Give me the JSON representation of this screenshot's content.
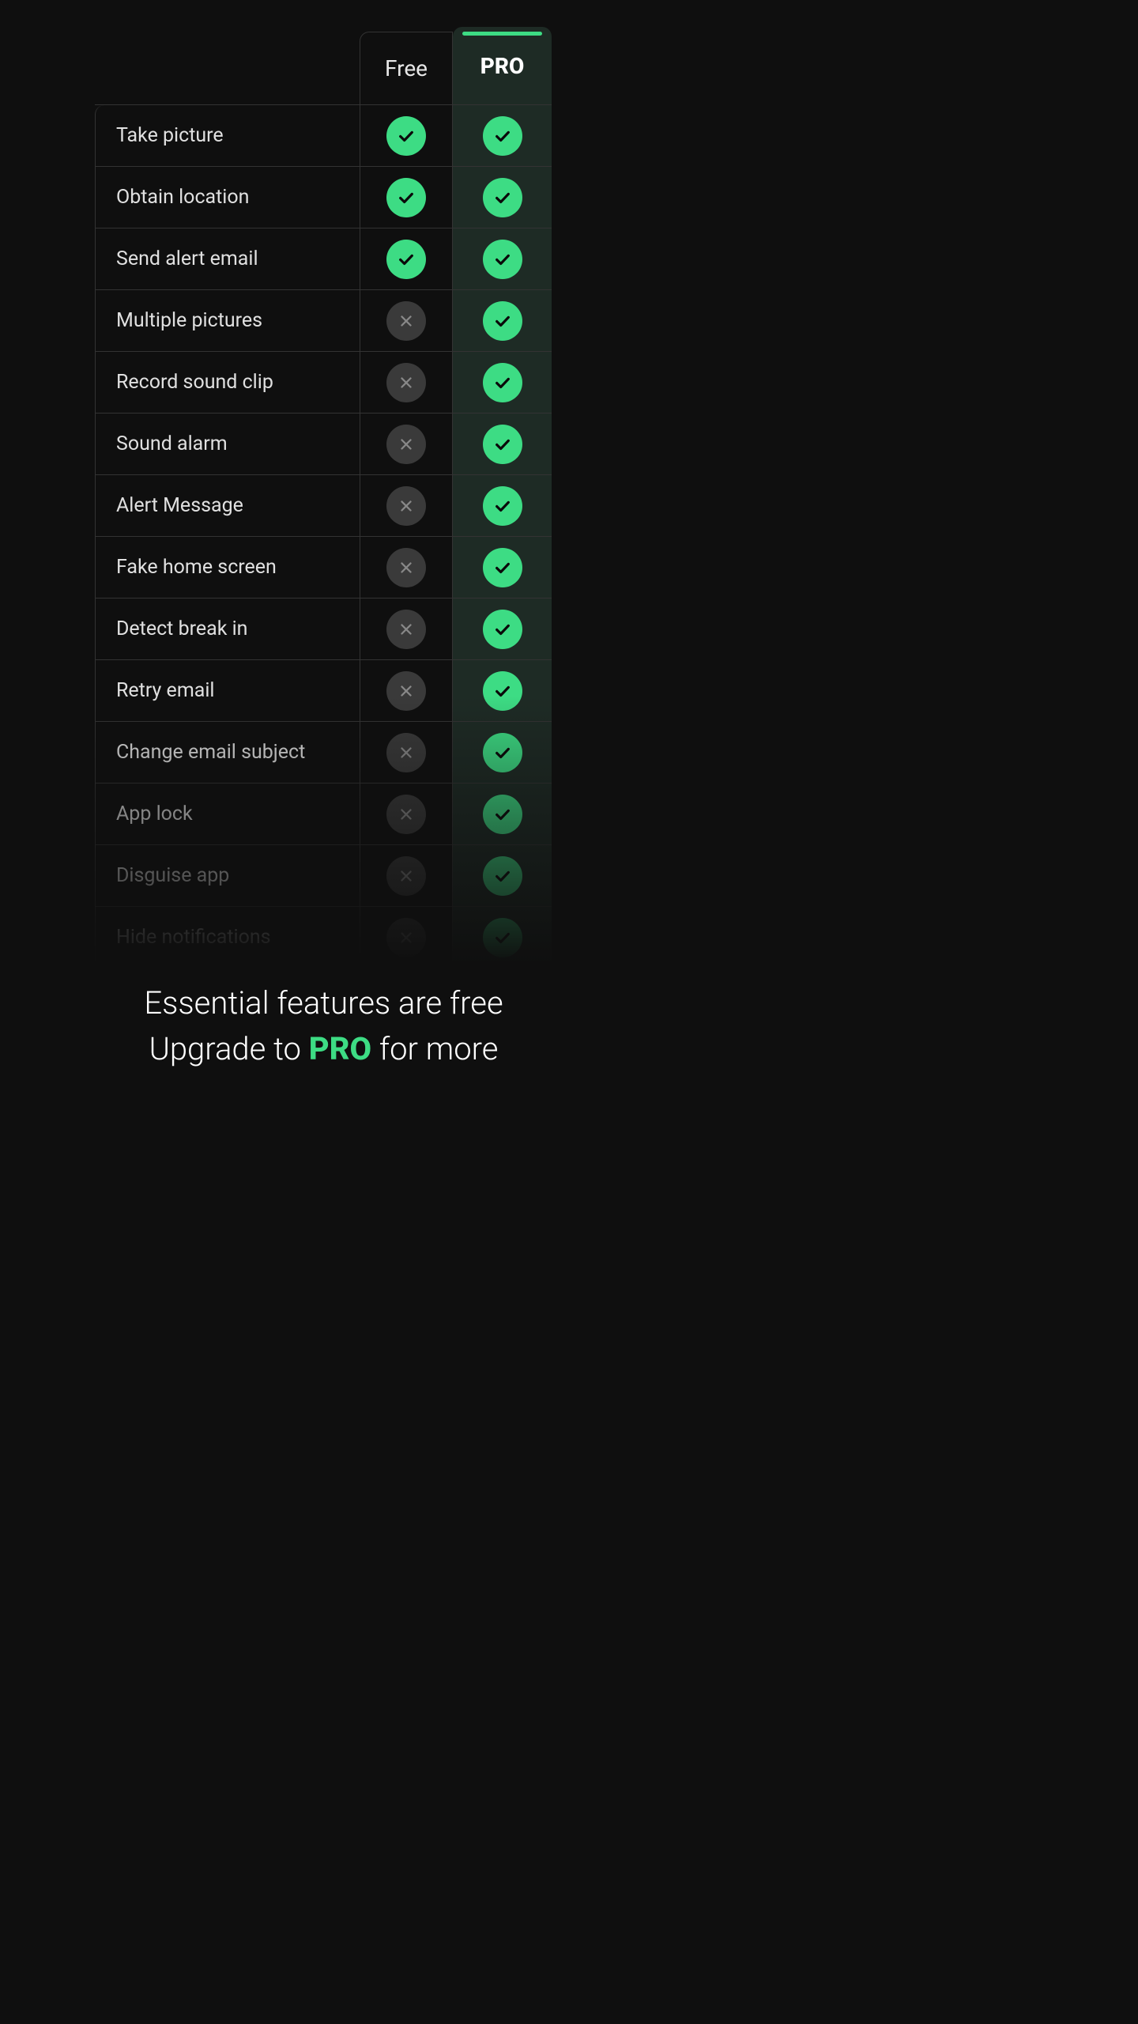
{
  "headers": {
    "free": "Free",
    "pro": "PRO"
  },
  "features": [
    {
      "label": "Take picture",
      "free": true,
      "pro": true
    },
    {
      "label": "Obtain location",
      "free": true,
      "pro": true
    },
    {
      "label": "Send alert email",
      "free": true,
      "pro": true
    },
    {
      "label": "Multiple pictures",
      "free": false,
      "pro": true
    },
    {
      "label": "Record sound clip",
      "free": false,
      "pro": true
    },
    {
      "label": "Sound alarm",
      "free": false,
      "pro": true
    },
    {
      "label": "Alert Message",
      "free": false,
      "pro": true
    },
    {
      "label": "Fake home screen",
      "free": false,
      "pro": true
    },
    {
      "label": "Detect break in",
      "free": false,
      "pro": true
    },
    {
      "label": "Retry email",
      "free": false,
      "pro": true
    },
    {
      "label": "Change email subject",
      "free": false,
      "pro": true
    },
    {
      "label": "App lock",
      "free": false,
      "pro": true
    },
    {
      "label": "Disguise app",
      "free": false,
      "pro": true
    },
    {
      "label": "Hide notifications",
      "free": false,
      "pro": true
    }
  ],
  "tagline": {
    "line1": "Essential features are free",
    "line2_before": "Upgrade to ",
    "line2_pro": "PRO",
    "line2_after": " for more"
  },
  "colors": {
    "accent": "#3ddc84",
    "bg": "#0f0f0f",
    "pro_col_bg": "#1e2b25",
    "cross_bg": "#3a3a3a"
  }
}
